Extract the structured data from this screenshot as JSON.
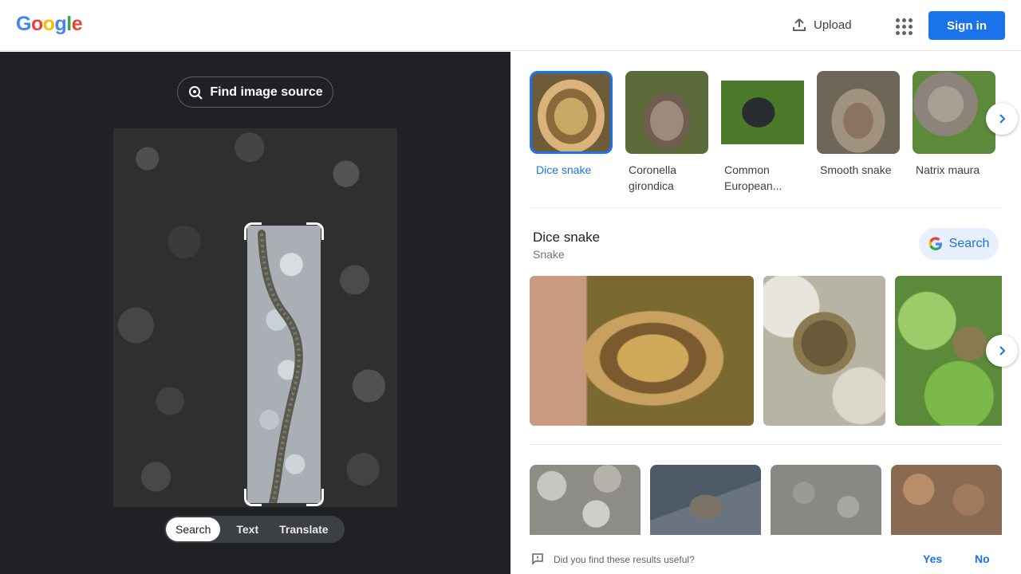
{
  "header": {
    "logo": [
      "G",
      "o",
      "o",
      "g",
      "l",
      "e"
    ],
    "logo_colors": [
      "#4285F4",
      "#EA4335",
      "#FBBC05",
      "#4285F4",
      "#34A853",
      "#EA4335"
    ],
    "upload_label": "Upload",
    "signin_label": "Sign in"
  },
  "left": {
    "find_source_label": "Find image source",
    "modes": [
      "Search",
      "Text",
      "Translate"
    ],
    "active_mode": "Search"
  },
  "right": {
    "thumbnails": [
      {
        "label": "Dice snake",
        "selected": true
      },
      {
        "label": "Coronella girondica",
        "selected": false
      },
      {
        "label": "Common European...",
        "selected": false
      },
      {
        "label": "Smooth snake",
        "selected": false
      },
      {
        "label": "Natrix maura",
        "selected": false
      }
    ],
    "entity": {
      "title": "Dice snake",
      "subtitle": "Snake",
      "search_label": "Search"
    },
    "feedback": {
      "question": "Did you find these results useful?",
      "yes": "Yes",
      "no": "No"
    }
  },
  "colors": {
    "accent": "#1a73e8",
    "dark_panel": "#202124"
  }
}
